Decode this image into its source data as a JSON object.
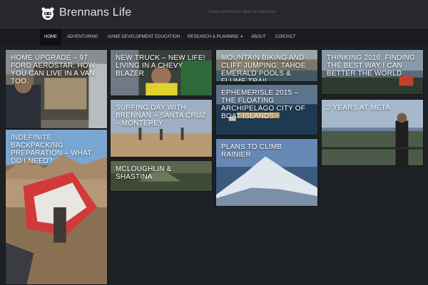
{
  "site": {
    "title": "Brennans Life",
    "tagline": "Crazy adventures open to everyone",
    "logo_icon": "robot-face-icon"
  },
  "nav": {
    "items": [
      {
        "label": "HOME",
        "active": true
      },
      {
        "label": "ADVENTURING",
        "active": false
      },
      {
        "label": "GAME DEVELOPMENT EDUCATION",
        "active": false
      },
      {
        "label": "RESEARCH & PLANNING",
        "active": false,
        "has_dropdown": true,
        "caret_icon": "caret-down-icon"
      },
      {
        "label": "ABOUT",
        "active": false
      },
      {
        "label": "CONTACT",
        "active": false
      }
    ]
  },
  "posts": [
    {
      "title": "HOME UPGRADE – 97 FORD AEROSTAR: HOW YOU CAN LIVE IN A VAN TOO."
    },
    {
      "title": "NEW TRUCK – NEW LIFE! LIVING IN A CHEVY BLAZER"
    },
    {
      "title": "MOUNTAIN BIKING AND CLIFF JUMPING: TAHOE EMERALD POOLS & FLUME TRAIL"
    },
    {
      "title": "THINKING 2016: FINDING THE BEST WAY I CAN BETTER THE WORLD"
    },
    {
      "title": "INDEFINITE BACKPACKING PREPARATION – WHAT DO I NEED?"
    },
    {
      "title": "SURFING DAY WITH BRENNAN – SANTA CRUZ – MONTEREY"
    },
    {
      "title": "EPHEMERISLE 2015 – THE FLOATING ARCHIPELAGO CITY OF BOAT ISLANDS"
    },
    {
      "title": "2 YEARS AT META"
    },
    {
      "title": "PLANS TO CLIMB RAINIER"
    },
    {
      "title": "MCLOUGHLIN & SHASTINA"
    }
  ],
  "colors": {
    "header_bg": "#26282c",
    "nav_bg": "#1b1c1f",
    "content_bg": "#1d2024",
    "title_text": "#ffffff"
  }
}
